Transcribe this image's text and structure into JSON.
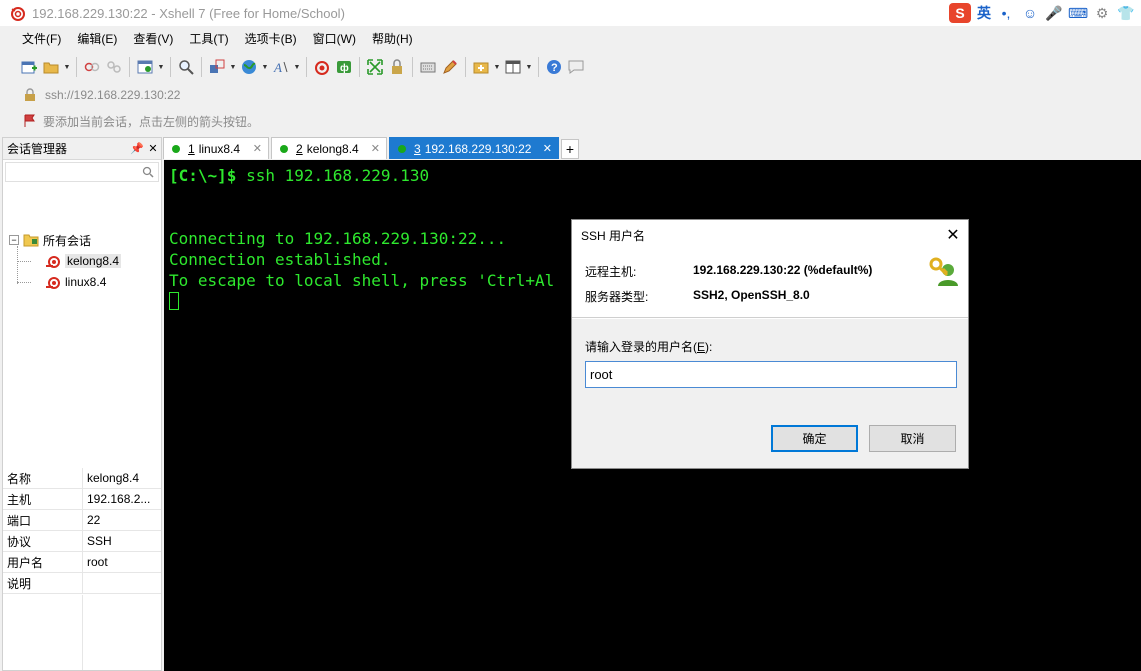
{
  "window": {
    "title": "192.168.229.130:22 - Xshell 7 (Free for Home/School)",
    "tray": {
      "ime_brand": "S",
      "ime_lang": "英"
    }
  },
  "menu": [
    "文件(F)",
    "编辑(E)",
    "查看(V)",
    "工具(T)",
    "选项卡(B)",
    "窗口(W)",
    "帮助(H)"
  ],
  "address": {
    "url": "ssh://192.168.229.130:22"
  },
  "hint": {
    "text": "要添加当前会话，点击左侧的箭头按钮。"
  },
  "session_manager": {
    "title": "会话管理器",
    "tree": {
      "root": "所有会话",
      "items": [
        "kelong8.4",
        "linux8.4"
      ],
      "selected": "kelong8.4"
    },
    "properties": [
      {
        "key": "名称",
        "value": "kelong8.4"
      },
      {
        "key": "主机",
        "value": "192.168.2..."
      },
      {
        "key": "端口",
        "value": "22"
      },
      {
        "key": "协议",
        "value": "SSH"
      },
      {
        "key": "用户名",
        "value": "root"
      },
      {
        "key": "说明",
        "value": ""
      }
    ]
  },
  "tabs": [
    {
      "num": "1",
      "label": "linux8.4",
      "active": false
    },
    {
      "num": "2",
      "label": "kelong8.4",
      "active": false
    },
    {
      "num": "3",
      "label": "192.168.229.130:22",
      "active": true
    }
  ],
  "terminal": {
    "prompt": "[C:\\~]$",
    "command": " ssh 192.168.229.130",
    "lines": [
      "Connecting to 192.168.229.130:22...",
      "Connection established.",
      "To escape to local shell, press 'Ctrl+Al"
    ],
    "color": "#2ee82e"
  },
  "dialog": {
    "title": "SSH 用户名",
    "remote_host_label": "远程主机:",
    "remote_host_value": "192.168.229.130:22 (%default%)",
    "server_type_label": "服务器类型:",
    "server_type_value": "SSH2, OpenSSH_8.0",
    "prompt_label": "请输入登录的用户名(",
    "prompt_key": "E",
    "prompt_label_end": "):",
    "username": "root",
    "ok_label": "确定",
    "cancel_label": "取消"
  },
  "colors": {
    "accent": "#1e7ad0",
    "terminal_bg": "#000000"
  }
}
